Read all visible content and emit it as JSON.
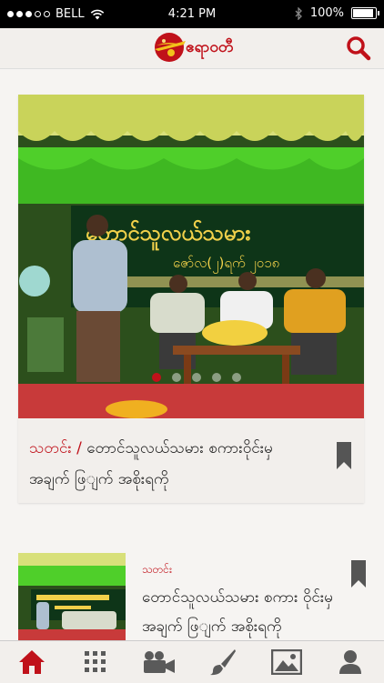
{
  "status_bar": {
    "carrier": "BELL",
    "time": "4:21 PM",
    "battery": "100%",
    "battery_level": 1.0
  },
  "header": {
    "logo_text": "ဧရာဝတီ",
    "search_icon": "search-icon"
  },
  "featured": {
    "category": "သတင်း",
    "separator": "/",
    "title": "တောင်သူလယ်သမား စကားဝိုင်းမှ အချက် ဖြျက် အစိုးရကို",
    "carousel_total": 5,
    "carousel_active": 1,
    "banner_line1": "တောင်သူလယ်သမား",
    "banner_line2": "ဇော်လ(၂)ရက် ၂၀၁၈"
  },
  "list": [
    {
      "category": "သတင်း",
      "title": "တောင်သူလယ်သမား စကား ဝိုင်းမှ အချက် ဖြျက် အစိုးရကို"
    }
  ],
  "tab_bar": {
    "tabs": [
      {
        "icon": "home-icon",
        "active": true
      },
      {
        "icon": "grid-icon",
        "active": false
      },
      {
        "icon": "video-camera-icon",
        "active": false
      },
      {
        "icon": "paintbrush-icon",
        "active": false
      },
      {
        "icon": "image-icon",
        "active": false
      },
      {
        "icon": "user-icon",
        "active": false
      }
    ]
  },
  "colors": {
    "accent": "#c0111a",
    "header_bg": "#f2efec",
    "tab_inactive": "#5a5a5a"
  }
}
